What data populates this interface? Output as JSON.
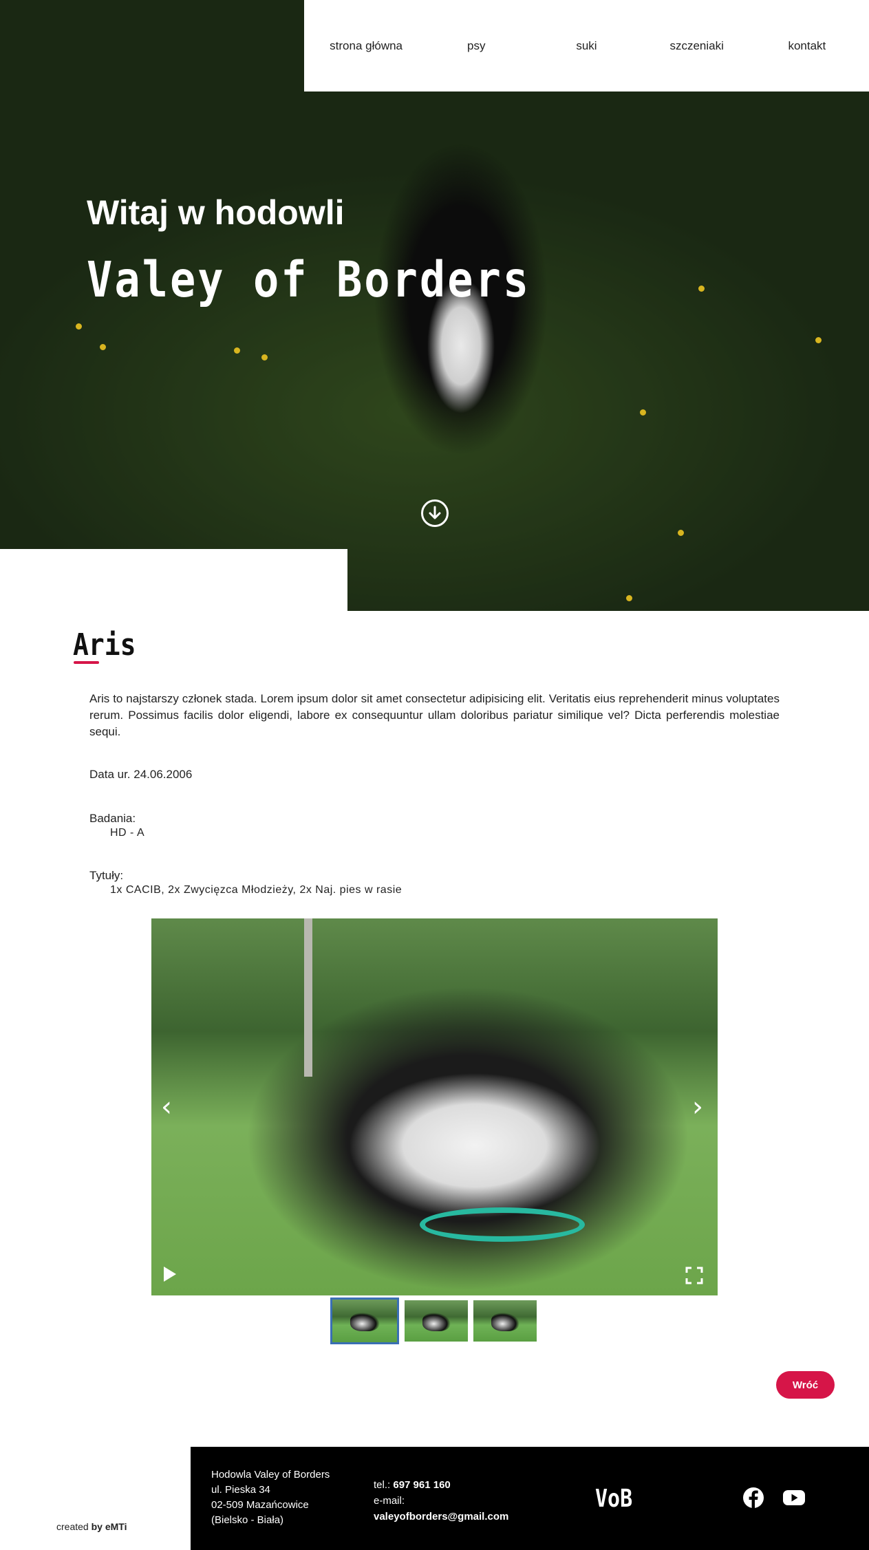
{
  "nav": {
    "items": [
      "strona główna",
      "psy",
      "suki",
      "szczeniaki",
      "kontakt"
    ]
  },
  "hero": {
    "title": "Witaj w hodowli",
    "brand": "Valey of Borders"
  },
  "dog": {
    "name": "Aris",
    "description": "Aris to najstarszy członek stada. Lorem ipsum dolor sit amet consectetur adipisicing elit. Veritatis eius reprehenderit minus voluptates rerum. Possimus facilis dolor eligendi, labore ex consequuntur ullam doloribus pariatur similique vel? Dicta perferendis molestiae sequi.",
    "birth": "Data ur. 24.06.2006",
    "tests_label": "Badania:",
    "tests_value": "HD - A",
    "titles_label": "Tytuły:",
    "titles_value": "1x CACIB, 2x Zwycięzca Młodzieży, 2x Naj. pies w rasie"
  },
  "gallery": {
    "prev_icon": "chevron-left-icon",
    "next_icon": "chevron-right-icon",
    "play_icon": "play-icon",
    "fullscreen_icon": "fullscreen-icon",
    "thumbnails": 3,
    "active_thumbnail": 1
  },
  "actions": {
    "back_label": "Wróć"
  },
  "footer": {
    "created_prefix": "created ",
    "created_by": "by eMTi",
    "address": [
      "Hodowla Valey of Borders",
      "ul. Pieska 34",
      "02-509 Mazańcowice",
      "(Bielsko - Biała)"
    ],
    "tel_label": "tel.: ",
    "tel": "697 961 160",
    "email_label": "e-mail:",
    "email": "valeyofborders@gmail.com",
    "logo": "VoB",
    "social": [
      "facebook-icon",
      "youtube-icon"
    ]
  },
  "colors": {
    "accent": "#d61548",
    "footer_bg": "#000000",
    "thumb_active_border": "#3a6fb4"
  }
}
